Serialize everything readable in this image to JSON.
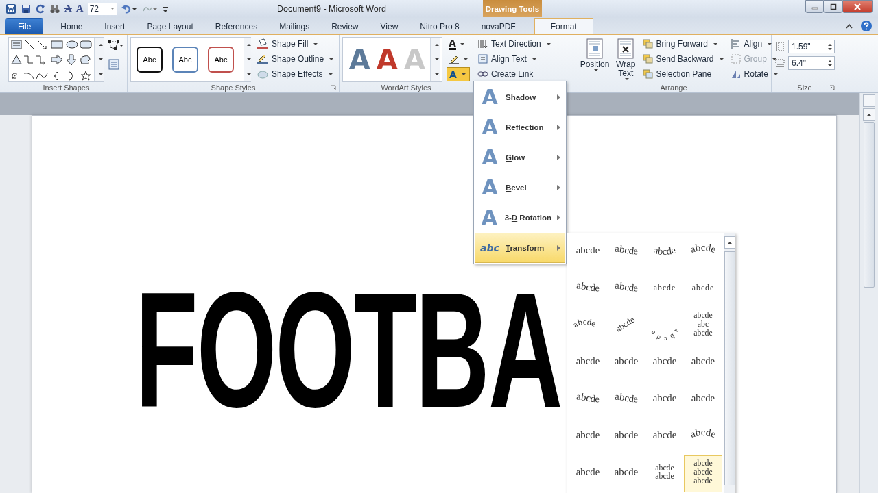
{
  "window": {
    "title": "Document9  -  Microsoft Word",
    "context_tab": "Drawing Tools"
  },
  "quick_access": {
    "glyphs": [
      "A",
      "A"
    ],
    "font_size": "72"
  },
  "tabs": [
    {
      "label": "File",
      "kind": "file",
      "selected": false
    },
    {
      "label": "Home",
      "kind": "tab",
      "selected": false
    },
    {
      "label": "Insert",
      "kind": "tab",
      "selected": false
    },
    {
      "label": "Page Layout",
      "kind": "tab",
      "selected": false
    },
    {
      "label": "References",
      "kind": "tab",
      "selected": false
    },
    {
      "label": "Mailings",
      "kind": "tab",
      "selected": false
    },
    {
      "label": "Review",
      "kind": "tab",
      "selected": false
    },
    {
      "label": "View",
      "kind": "tab",
      "selected": false
    },
    {
      "label": "Nitro Pro 8",
      "kind": "tab",
      "selected": false
    },
    {
      "label": "novaPDF",
      "kind": "tab",
      "selected": false
    },
    {
      "label": "Format",
      "kind": "tab",
      "selected": true
    }
  ],
  "ribbon": {
    "insert_shapes": {
      "label": "Insert Shapes"
    },
    "shape_styles": {
      "label": "Shape Styles",
      "presets": [
        {
          "text": "Abc",
          "color": "#111111"
        },
        {
          "text": "Abc",
          "color": "#5b84b8"
        },
        {
          "text": "Abc",
          "color": "#c0504d"
        }
      ],
      "commands": [
        "Shape Fill",
        "Shape Outline",
        "Shape Effects"
      ]
    },
    "wordart_styles": {
      "label": "WordArt Styles",
      "presets": [
        {
          "glyph": "A",
          "color": "#5d7a99"
        },
        {
          "glyph": "A",
          "color": "#c0392b"
        },
        {
          "glyph": "A",
          "color": "#c8c8c8"
        }
      ],
      "tools": [
        {
          "glyph": "A",
          "kind": "fill",
          "active": false
        },
        {
          "kind": "outline",
          "active": false
        },
        {
          "glyph": "A",
          "kind": "effects",
          "active": true
        }
      ]
    },
    "text": {
      "commands": [
        "Text Direction",
        "Align Text",
        "Create Link"
      ]
    },
    "arrange": {
      "label": "Arrange",
      "large": [
        "Position",
        "Wrap Text"
      ],
      "commands": [
        {
          "label": "Bring Forward",
          "disabled": false
        },
        {
          "label": "Send Backward",
          "disabled": false
        },
        {
          "label": "Selection Pane",
          "disabled": false
        },
        {
          "label": "Align",
          "disabled": false
        },
        {
          "label": "Group",
          "disabled": true
        },
        {
          "label": "Rotate",
          "disabled": false
        }
      ]
    },
    "size": {
      "label": "Size",
      "height": "1.59\"",
      "width": "6.4\""
    }
  },
  "document": {
    "wordart": "FOOTBA"
  },
  "text_effects_menu": {
    "items": [
      {
        "glyph": "A",
        "key": "S",
        "post": "hadow",
        "selected": false
      },
      {
        "glyph": "A",
        "key": "R",
        "post": "eflection",
        "selected": false
      },
      {
        "glyph": "A",
        "key": "G",
        "post": "low",
        "selected": false
      },
      {
        "glyph": "A",
        "key": "B",
        "post": "evel",
        "selected": false
      },
      {
        "glyph": "A",
        "pre": "3-",
        "key": "D",
        "post": " Rotation",
        "selected": false
      },
      {
        "glyph": "abc",
        "key": "T",
        "post": "ransform",
        "selected": true
      }
    ]
  },
  "transform_gallery": {
    "rows": [
      [
        {
          "kind": "plain",
          "lines": [
            "abcde"
          ],
          "selected": false
        },
        {
          "kind": "wave",
          "lines": [
            "abcde"
          ],
          "selected": false
        },
        {
          "kind": "sag",
          "lines": [
            "abcde"
          ],
          "selected": false
        },
        {
          "kind": "arch",
          "lines": [
            "abcde"
          ],
          "selected": false
        }
      ],
      [
        {
          "kind": "wave",
          "lines": [
            "abcde"
          ],
          "selected": false
        },
        {
          "kind": "wave",
          "lines": [
            "abcde"
          ],
          "selected": false
        },
        {
          "kind": "squash",
          "lines": [
            "abcde"
          ],
          "selected": false
        },
        {
          "kind": "squash",
          "lines": [
            "abcde"
          ],
          "selected": false
        }
      ],
      [
        {
          "kind": "curve",
          "lines": [
            "abcde"
          ],
          "selected": false
        },
        {
          "kind": "tilt",
          "lines": [
            "abcde"
          ],
          "selected": false
        },
        {
          "kind": "ring",
          "lines": [
            "abcde"
          ],
          "selected": false
        },
        {
          "kind": "stack",
          "lines": [
            "abcde",
            "abc",
            "abcde"
          ],
          "selected": false
        }
      ],
      [
        {
          "kind": "plain",
          "lines": [
            "abcde"
          ],
          "selected": false
        },
        {
          "kind": "plain",
          "lines": [
            "abcde"
          ],
          "selected": false
        },
        {
          "kind": "plain",
          "lines": [
            "abcde"
          ],
          "selected": false
        },
        {
          "kind": "plain",
          "lines": [
            "abcde"
          ],
          "selected": false
        }
      ],
      [
        {
          "kind": "wave",
          "lines": [
            "abcde"
          ],
          "selected": false
        },
        {
          "kind": "wave",
          "lines": [
            "abcde"
          ],
          "selected": false
        },
        {
          "kind": "plain",
          "lines": [
            "abcde"
          ],
          "selected": false
        },
        {
          "kind": "plain",
          "lines": [
            "abcde"
          ],
          "selected": false
        }
      ],
      [
        {
          "kind": "plain",
          "lines": [
            "abcde"
          ],
          "selected": false
        },
        {
          "kind": "plain",
          "lines": [
            "abcde"
          ],
          "selected": false
        },
        {
          "kind": "plain",
          "lines": [
            "abcde"
          ],
          "selected": false
        },
        {
          "kind": "arch",
          "lines": [
            "abcde"
          ],
          "selected": false
        }
      ],
      [
        {
          "kind": "plain",
          "lines": [
            "abcde"
          ],
          "selected": false
        },
        {
          "kind": "plain",
          "lines": [
            "abcde"
          ],
          "selected": false
        },
        {
          "kind": "stack",
          "lines": [
            "abcde",
            "abcde"
          ],
          "selected": false
        },
        {
          "kind": "stack",
          "lines": [
            "abcde",
            "abcde",
            "abcde"
          ],
          "selected": true
        }
      ]
    ]
  }
}
